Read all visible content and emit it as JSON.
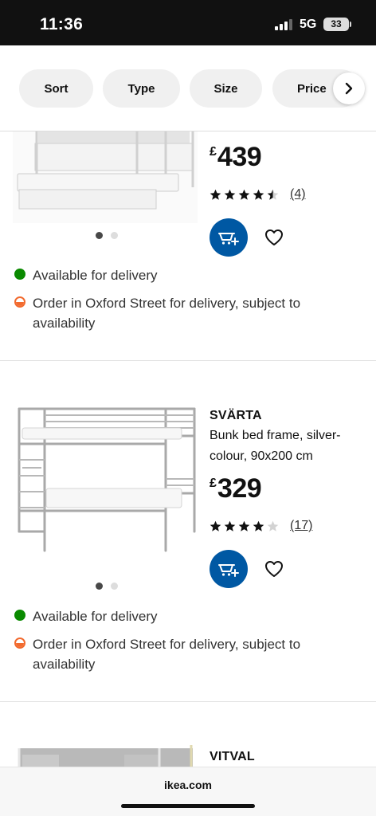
{
  "status_bar": {
    "time": "11:36",
    "network": "5G",
    "battery": "33"
  },
  "filters": {
    "chips": [
      "Sort",
      "Type",
      "Size",
      "Price"
    ],
    "scroll_icon": "chevron-right-icon"
  },
  "products": [
    {
      "price_currency": "£",
      "price_amount": "439",
      "rating_stars": 4.5,
      "review_count": "(4)",
      "availability": [
        {
          "status": "green",
          "text": "Available for delivery"
        },
        {
          "status": "orange",
          "text": "Order in Oxford Street for delivery, subject to availability"
        }
      ]
    },
    {
      "name": "SVÄRTA",
      "description": "Bunk bed frame, silver-colour, 90x200 cm",
      "price_currency": "£",
      "price_amount": "329",
      "rating_stars": 4,
      "review_count": "(17)",
      "availability": [
        {
          "status": "green",
          "text": "Available for delivery"
        },
        {
          "status": "orange",
          "text": "Order in Oxford Street for delivery, subject to availability"
        }
      ]
    },
    {
      "name": "VITVAL"
    }
  ],
  "browser": {
    "url": "ikea.com"
  },
  "colors": {
    "accent_blue": "#0058a3",
    "available_green": "#0a8a00",
    "store_orange": "#f26a2e"
  }
}
